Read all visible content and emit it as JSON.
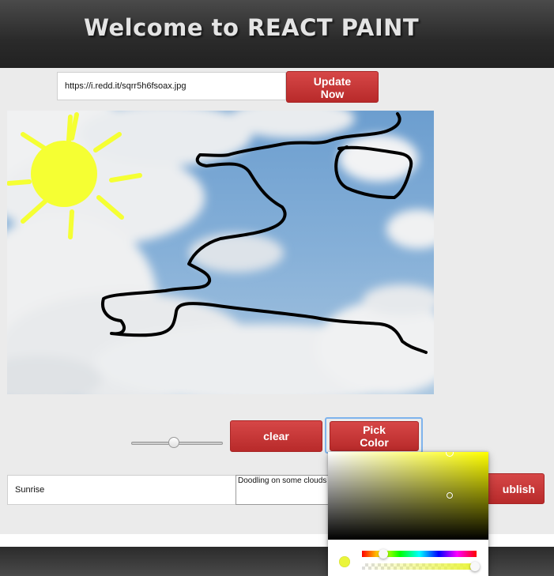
{
  "header": {
    "title": "Welcome to REACT PAINT"
  },
  "image_url": {
    "value": "https://i.redd.it/sqrr5h6fsoax.jpg"
  },
  "buttons": {
    "update_label_line1": "Update",
    "update_label_line2": "Now",
    "clear_label": "clear",
    "pick_label_line1": "Pick",
    "pick_label_line2": "Color",
    "publish_label": "ublish"
  },
  "brush_size": {
    "level": 0.47
  },
  "form": {
    "title_value": "Sunrise",
    "description_value": "Doodling on some clouds"
  },
  "colors": {
    "header_bg": "#333333",
    "button_red": "#c33535",
    "page_bg": "#ebebeb",
    "drawing_yellow": "#f5ff33",
    "stroke_black": "#000000",
    "selected_color": "#eaf53a"
  },
  "color_picker": {
    "hue": "yellow",
    "alpha": 1.0
  },
  "icons": {
    "sun_drawing": "sun-icon"
  }
}
